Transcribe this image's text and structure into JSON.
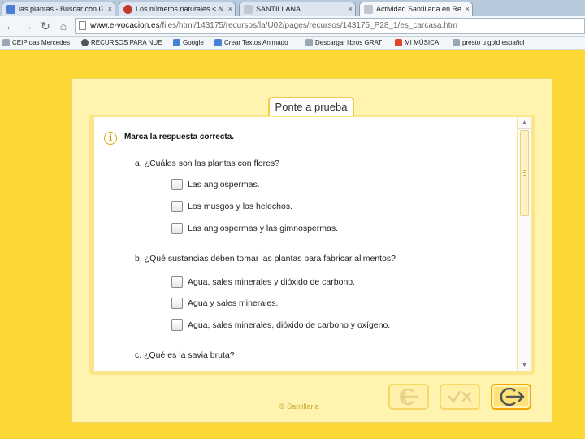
{
  "browser": {
    "tabs": [
      {
        "label": "las plantas - Buscar con Goog",
        "favicon_color": "#4a7fd6",
        "active": false
      },
      {
        "label": "Los números naturales < NÚM",
        "favicon_color": "#c0392b",
        "active": false
      },
      {
        "label": "SANTILLANA",
        "favicon_color": "#bfc7d1",
        "active": false
      },
      {
        "label": "Actividad Santillana en Red",
        "favicon_color": "#bfc7d1",
        "active": true
      }
    ],
    "tab_close_glyph": "×",
    "address": {
      "host": "www.e-vocacion.es",
      "path": "/files/html/143175/recursos/la/U02/pages/recursos/143175_P28_1/es_carcasa.htm"
    },
    "bookmarks": [
      {
        "label": "CEIP das Mercedes",
        "icon_color": "#9aa6b4"
      },
      {
        "label": "RECURSOS PARA NUE",
        "icon_color": "#555555"
      },
      {
        "label": "Google",
        "icon_color": "#4a7fd6"
      },
      {
        "label": "Crear Textos Animado",
        "icon_color": "#4a7fd6"
      },
      {
        "label": "Descargar libros GRAT",
        "icon_color": "#9aa6b4"
      },
      {
        "label": "MI MÚSICA",
        "icon_color": "#e0452b"
      },
      {
        "label": "presto u gold español",
        "icon_color": "#9aa6b4"
      }
    ]
  },
  "activity": {
    "tab_title": "Ponte a prueba",
    "instruction": "Marca la respuesta correcta.",
    "questions": [
      {
        "text": "a. ¿Cuáles son las plantas con flores?",
        "options": [
          "Las angiospermas.",
          "Los musgos y los helechos.",
          "Las angiospermas y las gimnospermas."
        ]
      },
      {
        "text": "b. ¿Qué sustancias deben tomar las plantas para fabricar alimentos?",
        "options": [
          "Agua, sales minerales y dióxido de carbono.",
          "Agua y sales minerales.",
          "Agua, sales minerales, dióxido de carbono y oxígeno."
        ]
      },
      {
        "text": "c. ¿Qué es la savia bruta?",
        "options": []
      }
    ],
    "credit": "© Santillana",
    "colors": {
      "background": "#fdd835",
      "frame": "#fff3b0",
      "accent": "#f0a800"
    }
  }
}
